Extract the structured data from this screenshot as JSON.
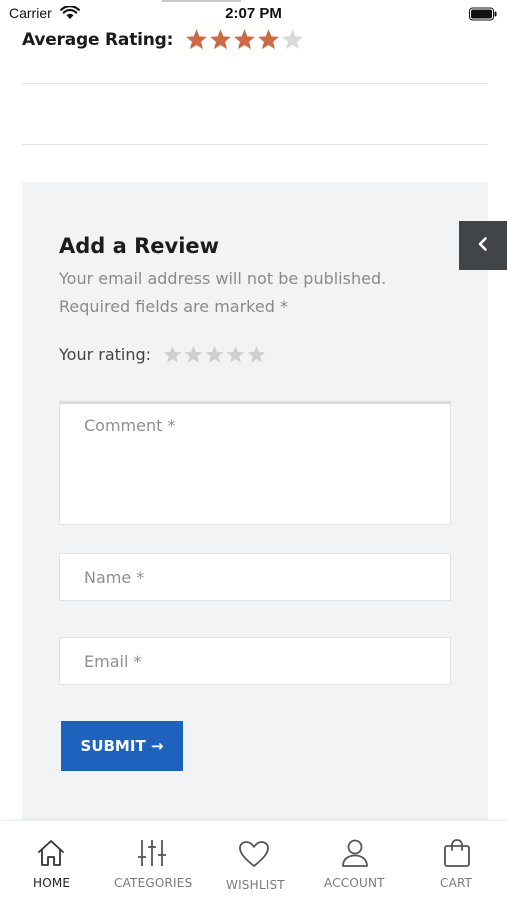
{
  "status_bar": {
    "carrier": "Carrier",
    "time": "2:07 PM"
  },
  "average_rating": {
    "label": "Average Rating:",
    "value": 4,
    "max": 5,
    "filled_color": "#cc6a44",
    "empty_color": "#d9d9d9"
  },
  "review_form": {
    "title": "Add a Review",
    "note_line1": "Your email address will not be published.",
    "note_line2": "Required fields are marked *",
    "rating_label": "Your rating:",
    "rating_value": 0,
    "rating_max": 5,
    "comment_placeholder": "Comment *",
    "name_placeholder": "Name *",
    "email_placeholder": "Email *",
    "submit_label": "SUBMIT →",
    "accent_color": "#1f62bd"
  },
  "tab_bar": {
    "items": [
      {
        "label": "HOME",
        "icon": "home-icon",
        "active": true
      },
      {
        "label": "CATEGORIES",
        "icon": "sliders-icon",
        "active": false
      },
      {
        "label": "WISHLIST",
        "icon": "heart-icon",
        "active": false
      },
      {
        "label": "ACCOUNT",
        "icon": "user-icon",
        "active": false
      },
      {
        "label": "CART",
        "icon": "bag-icon",
        "active": false
      }
    ]
  }
}
